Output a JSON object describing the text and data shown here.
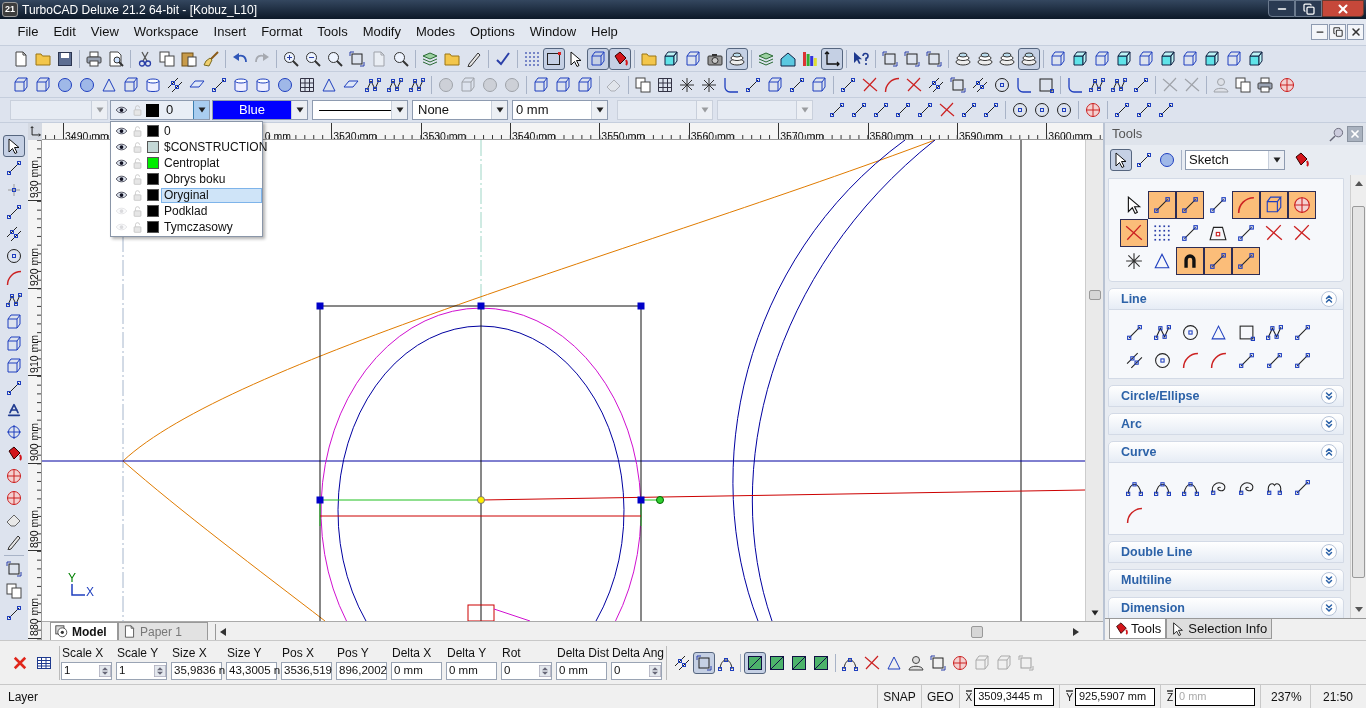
{
  "window": {
    "app_badge": "21",
    "title": "TurboCAD Deluxe 21.2 64-bit - [Kobuz_L10]"
  },
  "menu": [
    "File",
    "Edit",
    "View",
    "Workspace",
    "Insert",
    "Format",
    "Tools",
    "Modify",
    "Modes",
    "Options",
    "Window",
    "Help"
  ],
  "toolbars": [
    {
      "groups": [
        {
          "pressed": [
            false,
            false,
            false
          ]
        },
        {
          "pressed": [
            false,
            false
          ]
        },
        {
          "pressed": [
            false,
            false,
            false,
            false
          ]
        },
        {
          "pressed": [
            false,
            false
          ],
          "disabled": [
            false,
            true
          ]
        },
        {
          "pressed": [
            false,
            false,
            false,
            false,
            false,
            false
          ],
          "disabled": [
            false,
            false,
            false,
            false,
            true,
            false
          ]
        },
        {
          "pressed": [
            false,
            false,
            false
          ]
        },
        {
          "pressed": [
            false
          ]
        },
        {
          "pressed": [
            false,
            true,
            false,
            true,
            true
          ]
        },
        {
          "pressed": [
            false,
            false,
            false,
            false,
            true
          ]
        },
        {
          "pressed": [
            false,
            false,
            false,
            true
          ]
        },
        {
          "pressed": [
            false
          ]
        },
        {
          "pressed": [
            false,
            false,
            false
          ]
        },
        {
          "pressed": [
            false,
            false,
            false,
            true
          ]
        },
        {
          "pressed": [
            false,
            false,
            false,
            false,
            false,
            false,
            false,
            false,
            false,
            false
          ]
        }
      ]
    },
    {
      "groups": [
        {
          "pressed": [
            false,
            false,
            false,
            false,
            false,
            false,
            false,
            false,
            false,
            false,
            false,
            false,
            false,
            false,
            false,
            false,
            false,
            false,
            false
          ]
        },
        {
          "pressed": [
            false,
            false,
            false,
            false
          ],
          "disabled": [
            true,
            true,
            true,
            true
          ]
        },
        {
          "pressed": [
            false,
            false,
            false
          ]
        },
        {
          "pressed": [
            false
          ],
          "disabled": [
            true
          ]
        },
        {
          "pressed": [
            false,
            false,
            false,
            false,
            false,
            false,
            false,
            false,
            false
          ]
        },
        {
          "pressed": [
            false,
            false,
            false,
            false,
            false,
            false,
            false,
            false,
            false,
            false
          ]
        },
        {
          "pressed": [
            false,
            false,
            false,
            false
          ]
        },
        {
          "pressed": [
            false,
            false
          ],
          "disabled": [
            true,
            true
          ]
        },
        {
          "pressed": [
            false,
            false,
            false,
            false
          ],
          "disabled": [
            true,
            false,
            false,
            false
          ]
        }
      ]
    }
  ],
  "property_bar": {
    "layer": {
      "value": "0",
      "open": true
    },
    "color_dropdown": {
      "value": "Blue"
    },
    "pen": "None",
    "width": "0 mm"
  },
  "layers": [
    {
      "name": "0",
      "visible": true,
      "color": "#000000",
      "selected": false
    },
    {
      "name": "$CONSTRUCTION",
      "visible": true,
      "color": "#c4d8d6",
      "selected": false
    },
    {
      "name": "Centroplat",
      "visible": true,
      "color": "#00ee00",
      "selected": false
    },
    {
      "name": "Obrys boku",
      "visible": true,
      "color": "#000000",
      "selected": false
    },
    {
      "name": "Oryginal",
      "visible": true,
      "color": "#000000",
      "selected": true
    },
    {
      "name": "Podklad",
      "visible": false,
      "color": "#000000",
      "selected": false
    },
    {
      "name": "Tymczasowy",
      "visible": false,
      "color": "#000000",
      "selected": false
    }
  ],
  "snap_toolbar": {
    "groups": [
      {
        "pressed": [
          false,
          false,
          false,
          false,
          false,
          false,
          false,
          false
        ]
      },
      {
        "pressed": [
          false,
          false,
          false
        ]
      },
      {
        "pressed": [
          false
        ]
      },
      {
        "pressed": [
          false,
          false,
          false
        ]
      }
    ]
  },
  "left_toolbar": {
    "groups": [
      {
        "pressed": [
          true,
          false,
          false,
          false,
          false,
          false,
          false,
          false,
          false,
          false,
          false,
          false,
          false,
          false,
          false,
          false,
          false,
          false,
          false
        ]
      },
      {
        "pressed": [
          false,
          false,
          false
        ]
      }
    ]
  },
  "ruler": {
    "x_labels": [
      "3490 mm",
      "0 mm",
      "3520 mm",
      "3530 mm",
      "3540 mm",
      "3550 mm",
      "3560 mm",
      "3570 mm",
      "3580 mm",
      "3590 mm",
      "3600 mm"
    ],
    "y_labels": [
      "930 mm",
      "920 mm",
      "910 mm",
      "900 mm",
      "890 mm",
      "880 mm"
    ]
  },
  "canvas": {
    "axis_labels": {
      "y": "Y",
      "x": "X"
    }
  },
  "tools_panel": {
    "title": "Tools",
    "select_tools": {
      "pressed": [
        true,
        false,
        false
      ]
    },
    "mode": "Sketch",
    "snap_selected": [
      false,
      true,
      true,
      false,
      true,
      true,
      true,
      true,
      false,
      false,
      false,
      false,
      false,
      false,
      false,
      false,
      true,
      true,
      true
    ],
    "sections": [
      {
        "title": "Line",
        "expanded": true
      },
      {
        "title": "Circle/Ellipse",
        "expanded": false
      },
      {
        "title": "Arc",
        "expanded": false
      },
      {
        "title": "Curve",
        "expanded": true
      },
      {
        "title": "Double Line",
        "expanded": false
      },
      {
        "title": "Multiline",
        "expanded": false
      },
      {
        "title": "Dimension",
        "expanded": false
      }
    ],
    "tabs": [
      {
        "label": "Tools",
        "selected": true
      },
      {
        "label": "Selection Info",
        "selected": false
      }
    ]
  },
  "sheet_tabs": [
    {
      "label": "Model",
      "selected": true
    },
    {
      "label": "Paper 1",
      "selected": false
    }
  ],
  "inspector": {
    "fields": [
      {
        "label": "Scale X",
        "value": "1",
        "kind": "spin"
      },
      {
        "label": "Scale Y",
        "value": "1",
        "kind": "spin"
      },
      {
        "label": "Size X",
        "value": "35,9836 n",
        "kind": "text"
      },
      {
        "label": "Size Y",
        "value": "43,3005 n",
        "kind": "text"
      },
      {
        "label": "Pos X",
        "value": "3536,519",
        "kind": "text"
      },
      {
        "label": "Pos Y",
        "value": "896,2002",
        "kind": "text"
      },
      {
        "label": "Delta X",
        "value": "0 mm",
        "kind": "text"
      },
      {
        "label": "Delta Y",
        "value": "0 mm",
        "kind": "text"
      },
      {
        "label": "Rot",
        "value": "0",
        "kind": "spin"
      },
      {
        "label": "Delta Dist",
        "value": "0 mm",
        "kind": "text"
      },
      {
        "label": "Delta Ang",
        "value": "0",
        "kind": "spin"
      }
    ],
    "tools": {
      "groups": [
        {
          "pressed": [
            false,
            true,
            false
          ]
        },
        {
          "pressed": [
            true,
            false,
            false,
            false
          ]
        },
        {
          "pressed": [
            false,
            false,
            false,
            false,
            false,
            false,
            false,
            false,
            false
          ],
          "disabled": [
            false,
            false,
            false,
            false,
            false,
            false,
            true,
            true,
            true
          ]
        }
      ]
    }
  },
  "status_bar": {
    "prompt": "Layer",
    "modes": [
      "SNAP",
      "GEO"
    ],
    "coordinates": [
      {
        "axis": "X",
        "value": "3509,3445 m",
        "disabled": false
      },
      {
        "axis": "Y",
        "value": "925,5907 mm",
        "disabled": false
      },
      {
        "axis": "Z",
        "value": "0 mm",
        "disabled": true
      }
    ],
    "zoom": "237%",
    "time": "21:50"
  }
}
